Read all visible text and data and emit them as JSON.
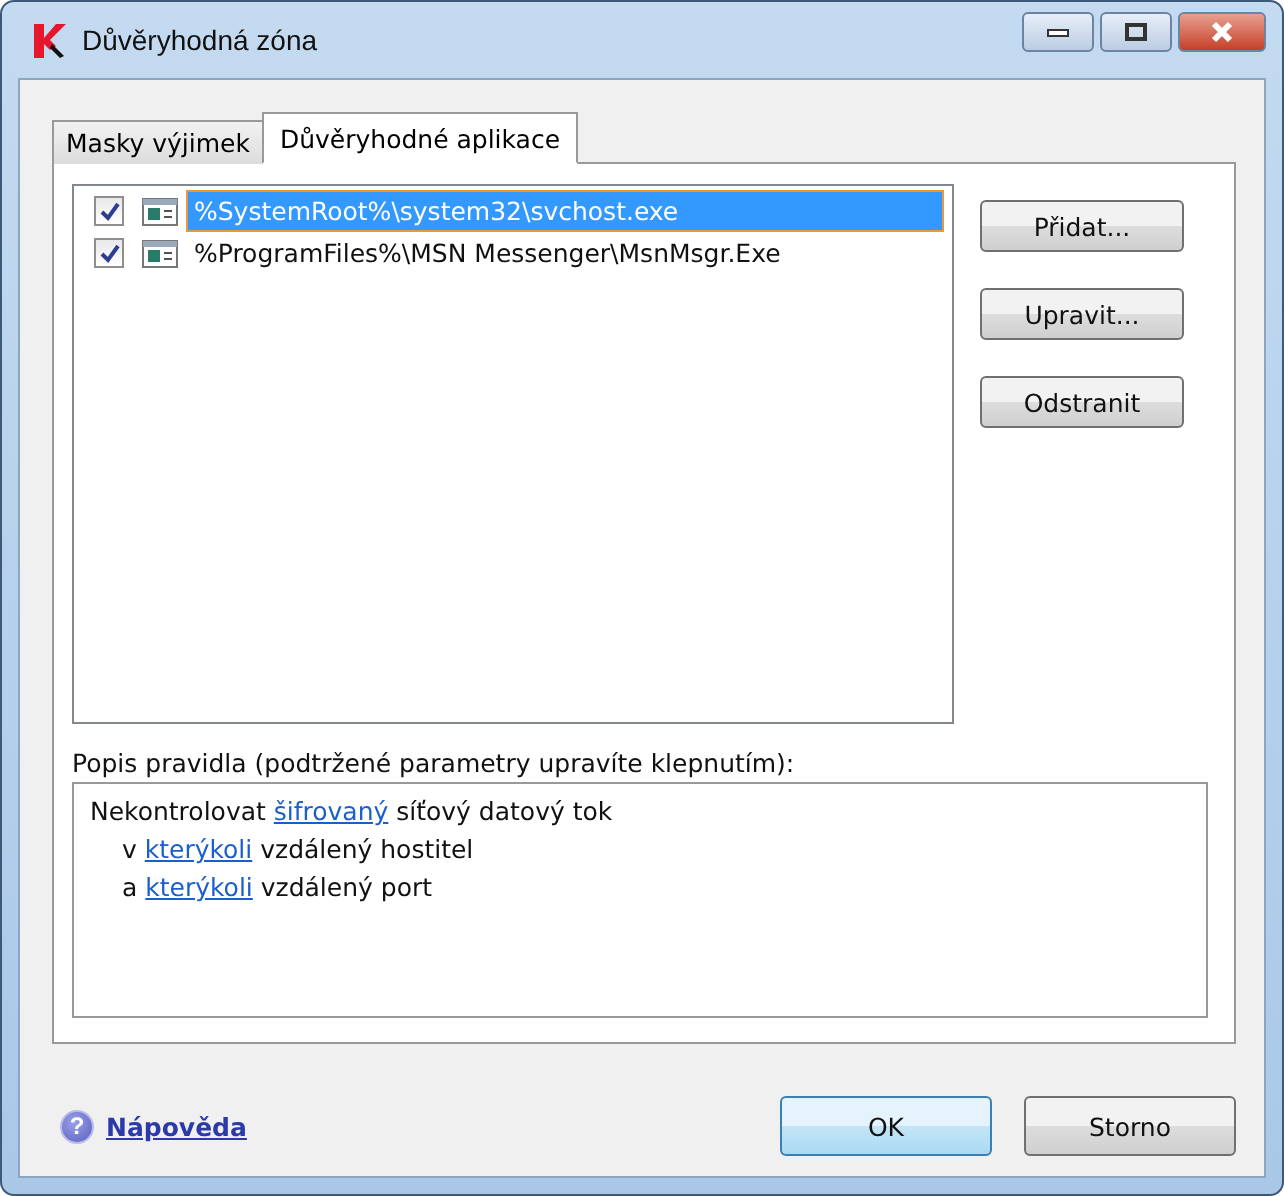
{
  "window": {
    "title": "Důvěryhodná zóna"
  },
  "tabs": [
    {
      "label": "Masky výjimek",
      "selected": false
    },
    {
      "label": "Důvěryhodné aplikace",
      "selected": true
    }
  ],
  "applications": [
    {
      "path": "%SystemRoot%\\system32\\svchost.exe",
      "checked": true,
      "selected": true
    },
    {
      "path": "%ProgramFiles%\\MSN Messenger\\MsnMsgr.Exe",
      "checked": true,
      "selected": false
    }
  ],
  "side_buttons": [
    "Přidat...",
    "Upravit...",
    "Odstranit"
  ],
  "description": {
    "label": "Popis pravidla (podtržené parametry upravíte klepnutím):",
    "lines": [
      {
        "indent": false,
        "parts": [
          {
            "text": "Nekontrolovat ",
            "link": false
          },
          {
            "text": "šifrovaný",
            "link": true
          },
          {
            "text": " síťový datový tok",
            "link": false
          }
        ]
      },
      {
        "indent": true,
        "parts": [
          {
            "text": "v ",
            "link": false
          },
          {
            "text": "kterýkoli",
            "link": true
          },
          {
            "text": " vzdálený hostitel",
            "link": false
          }
        ]
      },
      {
        "indent": true,
        "parts": [
          {
            "text": "a ",
            "link": false
          },
          {
            "text": "kterýkoli",
            "link": true
          },
          {
            "text": " vzdálený port",
            "link": false
          }
        ]
      }
    ]
  },
  "help_icon": "?",
  "help_link": "Nápověda",
  "buttons": [
    {
      "label": "OK",
      "default": true
    },
    {
      "label": "Storno",
      "default": false
    }
  ]
}
